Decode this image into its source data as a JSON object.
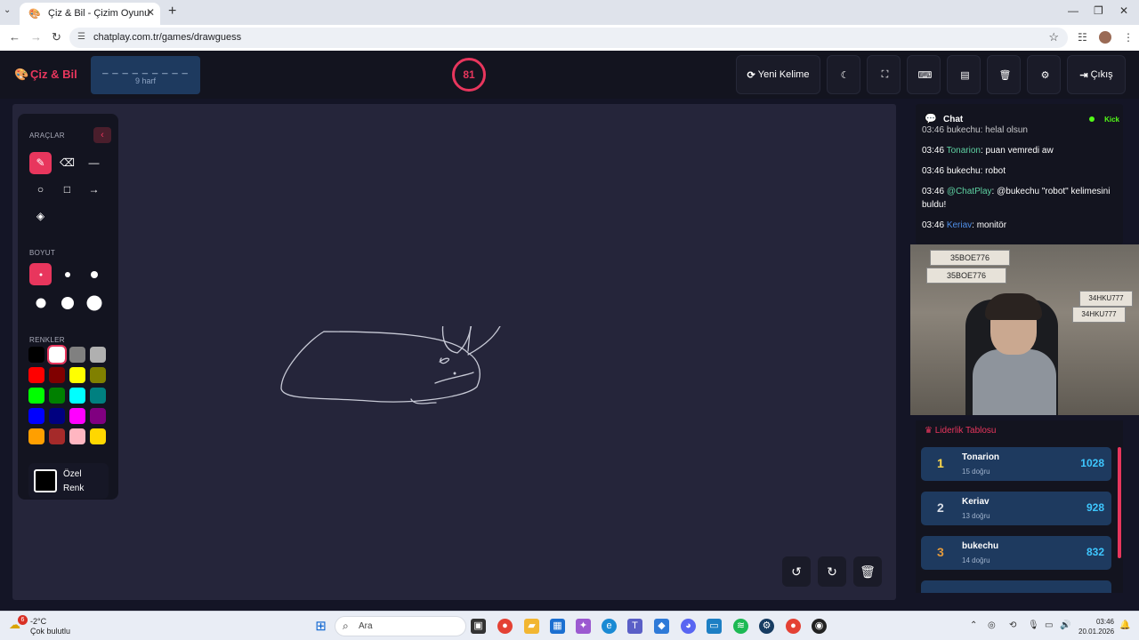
{
  "browser": {
    "tab_title": "Çiz & Bil - Çizim Oyunu",
    "url": "chatplay.com.tr/games/drawguess"
  },
  "header": {
    "logo": "Çiz & Bil",
    "word_mask": "_ _ _ _ _ _ _ _ _",
    "word_hint": "9 harf",
    "timer": "81",
    "new_word": "Yeni Kelime",
    "exit": "Çıkış"
  },
  "tools": {
    "tools_label": "ARAÇLAR",
    "size_label": "BOYUT",
    "colors_label": "RENKLER",
    "custom_color": "Özel Renk",
    "active_tool": "brush",
    "active_size_index": 0,
    "selected_color": "#ffffff",
    "colors": [
      "#000000",
      "#ffffff",
      "#808080",
      "#b0b0b0",
      "#ff0000",
      "#800000",
      "#ffff00",
      "#808000",
      "#00ff00",
      "#008000",
      "#00ffff",
      "#008080",
      "#0000ff",
      "#000080",
      "#ff00ff",
      "#800080",
      "#ff9f00",
      "#a52a2a",
      "#ffb6c1",
      "#ffd700"
    ]
  },
  "chat": {
    "title": "Chat",
    "platform": "Kick",
    "messages": [
      {
        "time": "03:46",
        "user": "bukechu",
        "user_color": "#ffffff",
        "text": ": helal olsun"
      },
      {
        "time": "03:46",
        "user": "Tonarion",
        "user_color": "#5fd3a3",
        "text": ": puan vemredi aw"
      },
      {
        "time": "03:46",
        "user": "bukechu",
        "user_color": "#ffffff",
        "text": ": robot"
      },
      {
        "time": "03:46",
        "user": "@ChatPlay",
        "user_color": "#5fd3a3",
        "text": ": @bukechu \"robot\" kelimesini buldu!"
      },
      {
        "time": "03:46",
        "user": "Keriav",
        "user_color": "#4f8fe8",
        "text": ": monitör"
      }
    ]
  },
  "webcam": {
    "sign_text": "35BOE776",
    "sign_text_2": "34HKU777"
  },
  "leaderboard": {
    "title": "Liderlik Tablosu",
    "rows": [
      {
        "rank": "1",
        "name": "Tonarion",
        "sub": "15 doğru",
        "score": "1028",
        "rank_color": "#ffd84a"
      },
      {
        "rank": "2",
        "name": "Keriav",
        "sub": "13 doğru",
        "score": "928",
        "rank_color": "#d8dde6"
      },
      {
        "rank": "3",
        "name": "bukechu",
        "sub": "14 doğru",
        "score": "832",
        "rank_color": "#e39a3c"
      }
    ]
  },
  "taskbar": {
    "search_placeholder": "Ara",
    "weather_badge": "6",
    "weather_temp": "-2°C",
    "weather_desc": "Çok bulutlu",
    "time": "03:46",
    "date": "20.01.2026"
  }
}
